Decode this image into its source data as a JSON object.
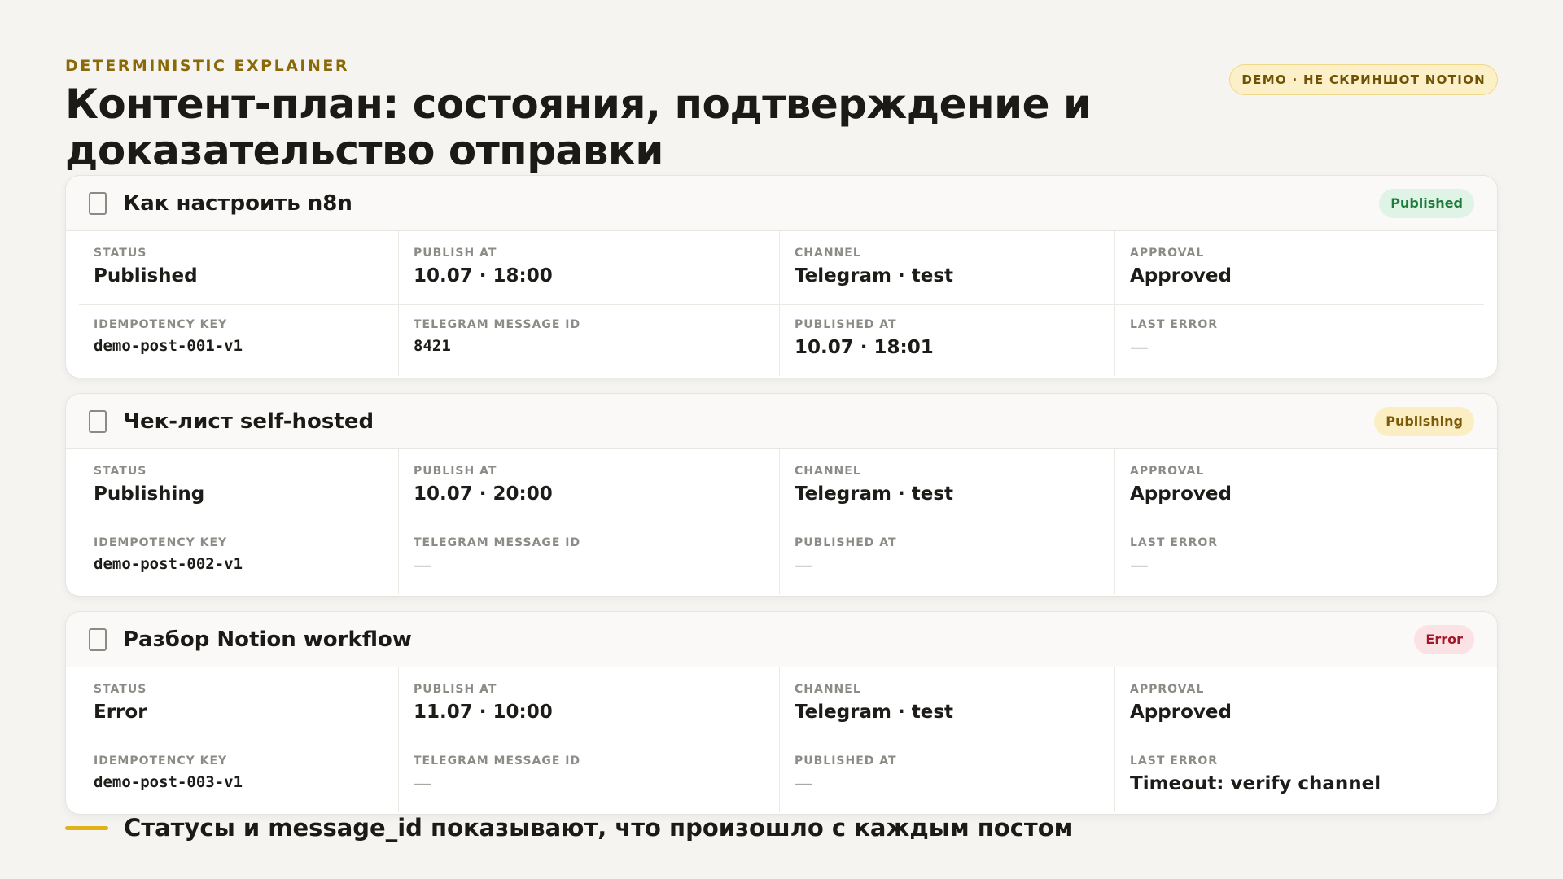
{
  "header": {
    "eyebrow": "DETERMINISTIC EXPLAINER",
    "title": "Контент-план: состояния, подтверждение и доказательство отправки",
    "demo_badge": "DEMO · НЕ СКРИНШОТ NOTION"
  },
  "labels": {
    "status": "STATUS",
    "publish_at": "PUBLISH AT",
    "channel": "CHANNEL",
    "approval": "APPROVAL",
    "idempotency_key": "IDEMPOTENCY KEY",
    "telegram_message_id": "TELEGRAM MESSAGE ID",
    "published_at": "PUBLISHED AT",
    "last_error": "LAST ERROR"
  },
  "cards": [
    {
      "title": "Как настроить n8n",
      "badge": "Published",
      "status": "Published",
      "publish_at": "10.07 · 18:00",
      "channel": "Telegram · test",
      "approval": "Approved",
      "idempotency_key": "demo-post-001-v1",
      "telegram_message_id": "8421",
      "published_at": "10.07 · 18:01",
      "last_error": "—"
    },
    {
      "title": "Чек-лист self-hosted",
      "badge": "Publishing",
      "status": "Publishing",
      "publish_at": "10.07 · 20:00",
      "channel": "Telegram · test",
      "approval": "Approved",
      "idempotency_key": "demo-post-002-v1",
      "telegram_message_id": "—",
      "published_at": "—",
      "last_error": "—"
    },
    {
      "title": "Разбор Notion workflow",
      "badge": "Error",
      "status": "Error",
      "publish_at": "11.07 · 10:00",
      "channel": "Telegram · test",
      "approval": "Approved",
      "idempotency_key": "demo-post-003-v1",
      "telegram_message_id": "—",
      "published_at": "—",
      "last_error": "Timeout: verify channel"
    }
  ],
  "footer": {
    "text": "Статусы и message_id показывают, что произошло с каждым постом"
  },
  "colors": {
    "accent": "#e2b21a",
    "published": "#1f7a3c",
    "publishing": "#7d5a08",
    "error": "#a3172a"
  }
}
